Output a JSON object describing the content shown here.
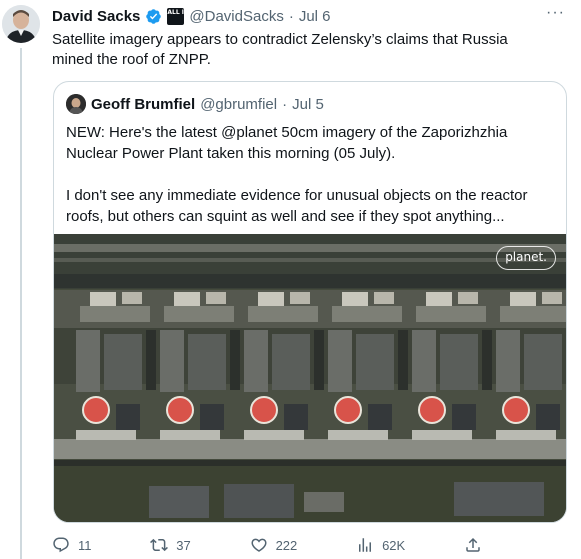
{
  "tweet": {
    "author_name": "David Sacks",
    "author_handle": "@DavidSacks",
    "separator": "·",
    "date": "Jul 6",
    "affiliate_badge": "ALL IN",
    "text": "Satellite imagery appears to contradict Zelensky’s claims that Russia mined the roof of ZNPP.",
    "more_label": "···"
  },
  "quoted_tweet": {
    "author_name": "Geoff Brumfiel",
    "author_handle": "@gbrumfiel",
    "separator": "·",
    "date": "Jul 5",
    "text": "NEW: Here's the latest @planet 50cm imagery of the Zaporizhzhia Nuclear Power Plant taken this morning (05 July).\n\nI don't see any immediate evidence for unusual objects on the reactor roofs, but others can squint as well and see if they spot anything...",
    "media": {
      "watermark": "planet.",
      "icon": "satellite-image"
    }
  },
  "actions": {
    "reply_count": "11",
    "repost_count": "37",
    "like_count": "222",
    "view_count": "62K",
    "icons": [
      "reply-icon",
      "repost-icon",
      "like-icon",
      "views-icon",
      "share-icon"
    ]
  },
  "colors": {
    "verified": "#1d9bf0",
    "muted": "#536471",
    "border": "#cfd9de",
    "reactor_dome": "#d8534a"
  }
}
